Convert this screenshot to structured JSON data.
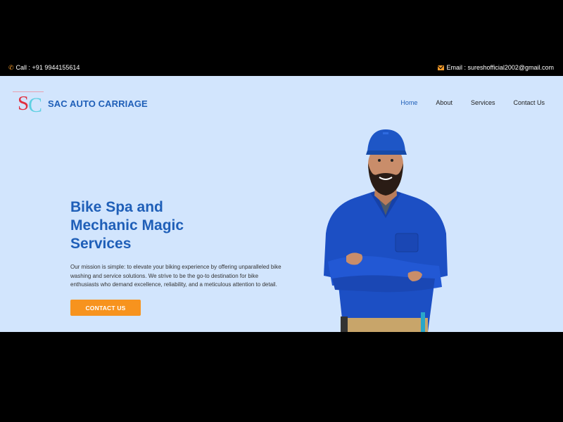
{
  "topbar": {
    "call_text": "Call : +91 9944155614",
    "email_text": "Email : sureshofficial2002@gmail.com",
    "call_icon": "phone-icon",
    "email_icon": "envelope-icon"
  },
  "brand": {
    "logo_letters": {
      "s": "S",
      "c": "C"
    },
    "name": "SAC AUTO CARRIAGE"
  },
  "nav": {
    "items": [
      {
        "label": "Home",
        "active": true
      },
      {
        "label": "About",
        "active": false
      },
      {
        "label": "Services",
        "active": false
      },
      {
        "label": "Contact Us",
        "active": false
      }
    ]
  },
  "hero": {
    "headline_lines": [
      "Bike Spa and",
      "Mechanic Magic",
      "Services"
    ],
    "description": "Our mission is simple: to elevate your biking experience by offering unparalleled bike washing and service solutions. We strive to be the go-to destination for bike enthusiasts who demand excellence, reliability, and a meticulous attention to detail.",
    "cta_label": "CONTACT US",
    "image": "mechanic-illustration"
  },
  "colors": {
    "topbar_bg": "#000000",
    "hero_bg": "#d2e5fd",
    "brand_blue": "#1f5fb8",
    "accent_orange": "#f7931e"
  }
}
